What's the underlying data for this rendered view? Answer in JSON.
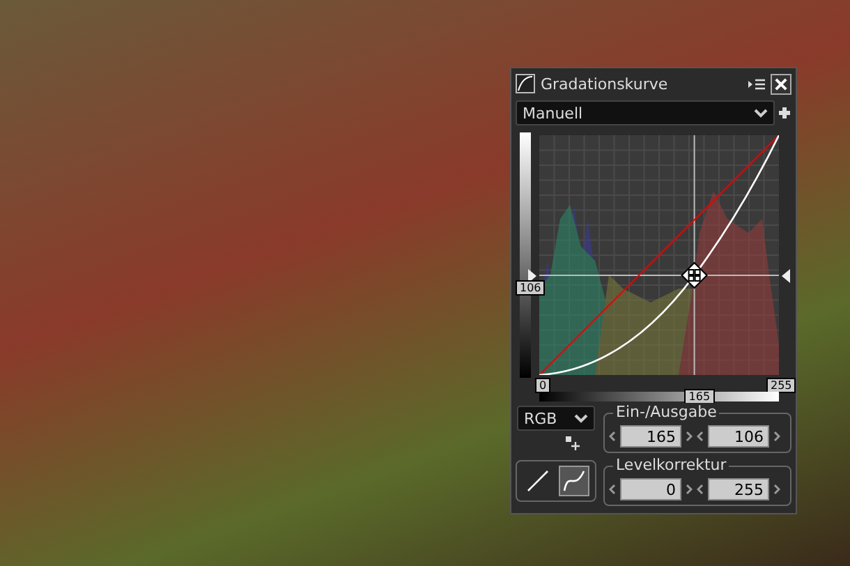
{
  "window": {
    "title": "Gradationskurve"
  },
  "preset": {
    "value": "Manuell"
  },
  "curve": {
    "input_marker": "165",
    "output_marker": "106",
    "black_point": "0",
    "white_point": "255"
  },
  "channel": {
    "value": "RGB"
  },
  "input_output": {
    "label": "Ein-/Ausgabe",
    "fields": [
      {
        "value": "165"
      },
      {
        "value": "106"
      }
    ]
  },
  "levels": {
    "label": "Levelkorrektur",
    "fields": [
      {
        "value": "0"
      },
      {
        "value": "255"
      }
    ]
  },
  "curve_modes": [
    {
      "kind": "linear",
      "selected": false
    },
    {
      "kind": "freehand",
      "selected": true
    }
  ]
}
